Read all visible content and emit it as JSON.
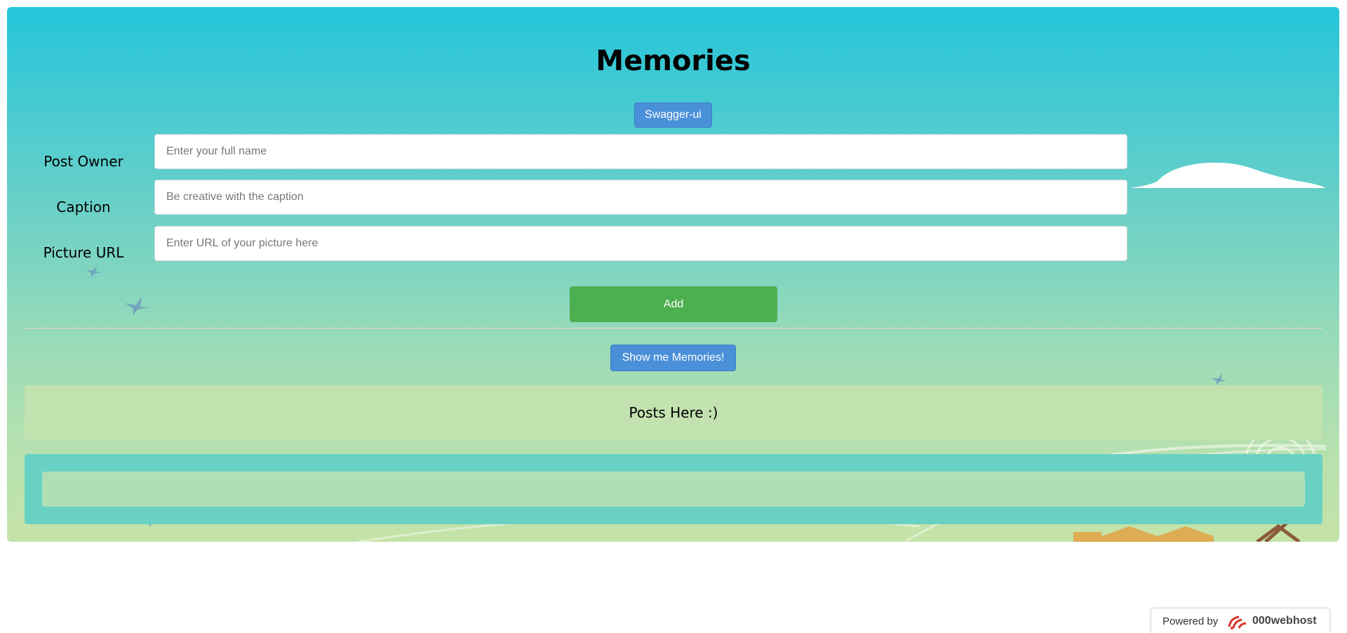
{
  "app": {
    "title": "Memories",
    "swagger_button": "Swagger-ui"
  },
  "form": {
    "post_owner": {
      "label": "Post Owner",
      "placeholder": "Enter your full name",
      "value": ""
    },
    "caption": {
      "label": "Caption",
      "placeholder": "Be creative with the caption",
      "value": ""
    },
    "picture_url": {
      "label": "Picture URL",
      "placeholder": "Enter URL of your picture here",
      "value": ""
    },
    "add_button": "Add"
  },
  "posts": {
    "show_button": "Show me Memories!",
    "header": "Posts Here :)"
  },
  "footer": {
    "powered_by": "Powered by",
    "brand": "000webhost"
  },
  "colors": {
    "accent_blue": "#4a90d9",
    "add_green": "#4caf50",
    "gradient_top": "#24c5da",
    "gradient_bottom": "#c5e3a8",
    "posts_header_bg": "#c2e2b0",
    "posts_container_bg": "#69d1c4"
  }
}
